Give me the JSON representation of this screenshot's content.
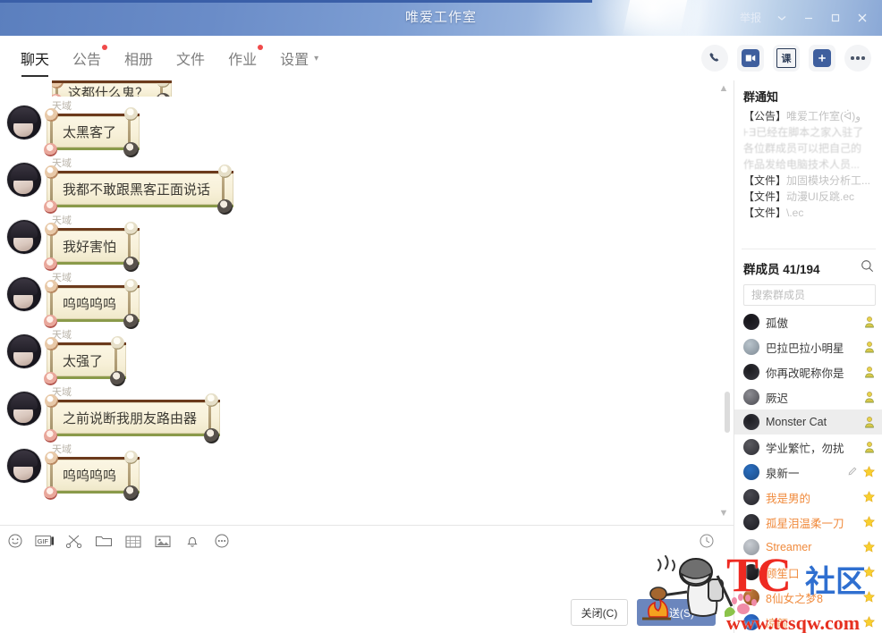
{
  "window": {
    "title": "唯爱工作室",
    "report_label": "举报",
    "chevron_icon": "chevron-down-icon",
    "minimize_icon": "minimize-icon",
    "maximize_icon": "maximize-icon",
    "close_icon": "close-icon"
  },
  "tabs": [
    {
      "label": "聊天",
      "active": true,
      "dot": false,
      "chevron": false
    },
    {
      "label": "公告",
      "active": false,
      "dot": true,
      "chevron": false
    },
    {
      "label": "相册",
      "active": false,
      "dot": false,
      "chevron": false
    },
    {
      "label": "文件",
      "active": false,
      "dot": false,
      "chevron": false
    },
    {
      "label": "作业",
      "active": false,
      "dot": true,
      "chevron": false
    },
    {
      "label": "设置",
      "active": false,
      "dot": false,
      "chevron": true
    }
  ],
  "top_icons": [
    {
      "name": "phone-call-icon",
      "glyph": "phone"
    },
    {
      "name": "video-call-icon",
      "glyph": "video"
    },
    {
      "name": "class-icon",
      "glyph": "课"
    },
    {
      "name": "add-member-icon",
      "glyph": "plus"
    },
    {
      "name": "more-options-icon",
      "glyph": "dots"
    }
  ],
  "messages": [
    {
      "sender": "天域",
      "text": "这都什么鬼？",
      "clipped": true
    },
    {
      "sender": "天域",
      "text": "太黑客了",
      "clipped": false
    },
    {
      "sender": "天域",
      "text": "我都不敢跟黑客正面说话",
      "clipped": false
    },
    {
      "sender": "天域",
      "text": "我好害怕",
      "clipped": false
    },
    {
      "sender": "天域",
      "text": "呜呜呜呜",
      "clipped": false
    },
    {
      "sender": "天域",
      "text": "太强了",
      "clipped": false
    },
    {
      "sender": "天域",
      "text": "之前说断我朋友路由器",
      "clipped": false
    },
    {
      "sender": "天域",
      "text": "呜呜呜呜",
      "clipped": false
    }
  ],
  "editor_toolbar": [
    {
      "name": "emoji-icon",
      "glyph": "smile"
    },
    {
      "name": "gif-icon",
      "glyph": "GIF"
    },
    {
      "name": "scissors-icon",
      "glyph": "scissors"
    },
    {
      "name": "folder-icon",
      "glyph": "folder"
    },
    {
      "name": "screenshot-icon",
      "glyph": "screenshot"
    },
    {
      "name": "image-icon",
      "glyph": "image"
    },
    {
      "name": "bell-icon",
      "glyph": "bell"
    },
    {
      "name": "more-tools-icon",
      "glyph": "dots"
    }
  ],
  "editor": {
    "history_icon": "history-clock-icon",
    "input_value": "",
    "input_placeholder": ""
  },
  "buttons": {
    "close_label": "关闭(C)",
    "send_label": "发送(S)"
  },
  "notice": {
    "title": "群通知",
    "lines": [
      {
        "tag": "【公告】",
        "text": "唯爱工作室(ᐛ)و"
      },
      {
        "tag": "",
        "text": "⊦Ǝ已经在脚本之家入驻了"
      },
      {
        "tag": "",
        "text": "各位群成员可以把自己的"
      },
      {
        "tag": "",
        "text": "作品发给电脑技术人员..."
      },
      {
        "tag": "【文件】",
        "text": "加固模块分析工..."
      },
      {
        "tag": "【文件】",
        "text": "动漫UI反跳.ec"
      },
      {
        "tag": "【文件】",
        "text": "\\.ec"
      }
    ]
  },
  "members_panel": {
    "title": "群成员 41/194",
    "search_icon": "search-icon",
    "search_placeholder": "搜索群成员",
    "search_value": "",
    "members": [
      {
        "name": "孤傲",
        "color": "normal",
        "rank": "green",
        "selected": false,
        "pen": false
      },
      {
        "name": "巴拉巴拉小明星",
        "color": "normal",
        "rank": "green",
        "selected": false,
        "pen": false
      },
      {
        "name": "你再改昵称你是",
        "color": "normal",
        "rank": "green",
        "selected": false,
        "pen": false
      },
      {
        "name": "厥迟",
        "color": "normal",
        "rank": "green",
        "selected": false,
        "pen": false
      },
      {
        "name": "Monster Cat",
        "color": "normal",
        "rank": "green",
        "selected": true,
        "pen": false
      },
      {
        "name": "学业繁忙，勿扰",
        "color": "normal",
        "rank": "green",
        "selected": false,
        "pen": false
      },
      {
        "name": "泉新一",
        "color": "normal",
        "rank": "star",
        "selected": false,
        "pen": true
      },
      {
        "name": "我是男的",
        "color": "orange",
        "rank": "star",
        "selected": false,
        "pen": false
      },
      {
        "name": "孤星泪温柔一刀",
        "color": "orange",
        "rank": "star",
        "selected": false,
        "pen": false
      },
      {
        "name": "Streamer",
        "color": "orange",
        "rank": "star",
        "selected": false,
        "pen": false
      },
      {
        "name": "顾笙口",
        "color": "orange",
        "rank": "star",
        "selected": false,
        "pen": false
      },
      {
        "name": "8仙女之梦8",
        "color": "orange",
        "rank": "star",
        "selected": false,
        "pen": false
      },
      {
        "name": "凉颜",
        "color": "orange",
        "rank": "star",
        "selected": false,
        "pen": false
      }
    ]
  },
  "watermark": {
    "brand": "TC",
    "community": "社区",
    "url": "www.tcsqw.com"
  },
  "colors": {
    "titlebar_blue": "#6a8cc8",
    "accent_blue": "#6b86bd",
    "badge_red": "#f04a4a",
    "member_orange": "#f08a3c",
    "watermark_red": "#ee2a22",
    "watermark_blue": "#2f6fd0"
  }
}
